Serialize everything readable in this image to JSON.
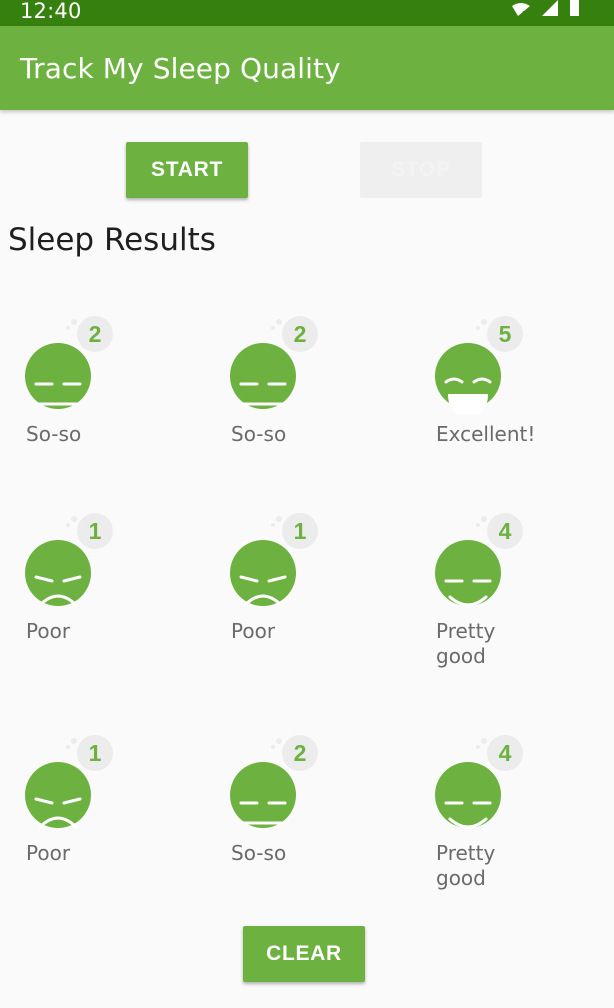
{
  "status_bar": {
    "time": "12:40"
  },
  "app_bar": {
    "title": "Track My Sleep Quality"
  },
  "controls": {
    "start_label": "START",
    "stop_label": "STOP",
    "clear_label": "CLEAR"
  },
  "section": {
    "title": "Sleep Results"
  },
  "accent_color": "#6db240",
  "nights": [
    {
      "score": "2",
      "label": "So-so",
      "face": "neutral"
    },
    {
      "score": "2",
      "label": "So-so",
      "face": "neutral"
    },
    {
      "score": "5",
      "label": "Excellent!",
      "face": "laugh"
    },
    {
      "score": "1",
      "label": "Poor",
      "face": "frown"
    },
    {
      "score": "1",
      "label": "Poor",
      "face": "frown"
    },
    {
      "score": "4",
      "label": "Pretty good",
      "face": "smile"
    },
    {
      "score": "1",
      "label": "Poor",
      "face": "frown"
    },
    {
      "score": "2",
      "label": "So-so",
      "face": "neutral"
    },
    {
      "score": "4",
      "label": "Pretty good",
      "face": "smile"
    }
  ]
}
